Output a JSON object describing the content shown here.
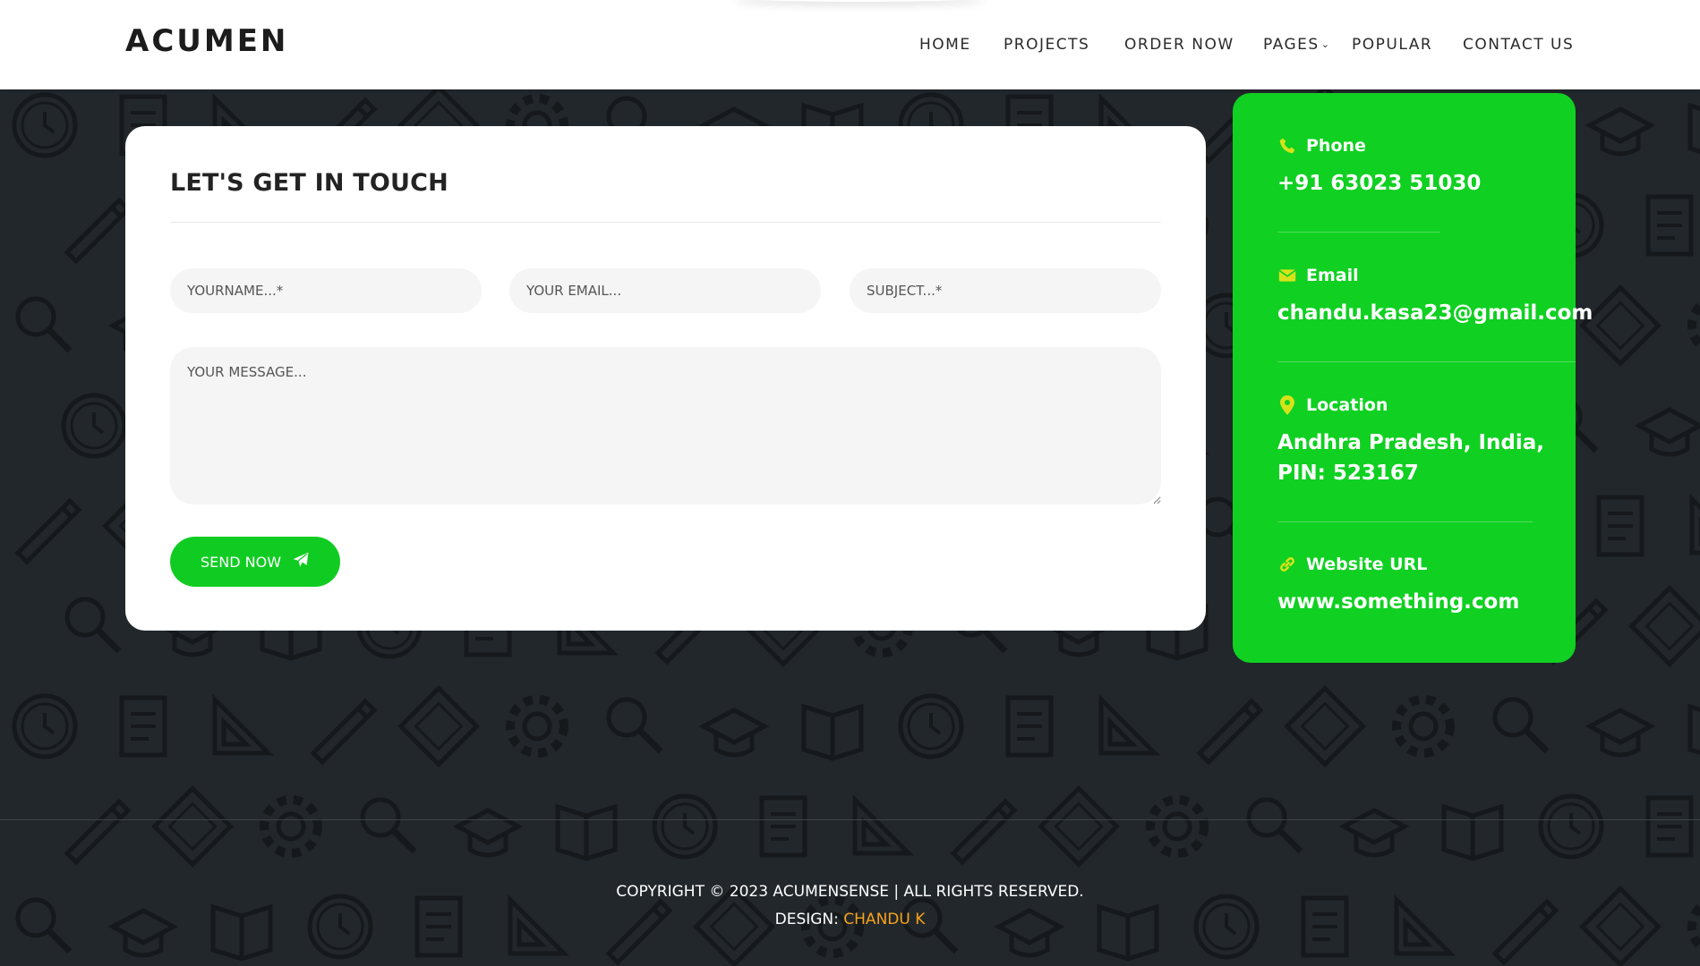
{
  "header": {
    "logo": "ACUMEN",
    "nav": [
      {
        "label": "HOME"
      },
      {
        "label": "PROJECTS"
      },
      {
        "label": "ORDER NOW"
      },
      {
        "label": "PAGES"
      },
      {
        "label": "POPULAR"
      },
      {
        "label": "CONTACT US"
      }
    ]
  },
  "contact_form": {
    "title": "LET'S GET IN TOUCH",
    "name_placeholder": "YOURNAME...*",
    "email_placeholder": "YOUR EMAIL...",
    "subject_placeholder": "SUBJECT...*",
    "message_placeholder": "YOUR MESSAGE...",
    "send_label": "SEND NOW"
  },
  "info": {
    "phone_label": "Phone",
    "phone_value": "+91 63023 51030",
    "email_label": "Email",
    "email_value": "chandu.kasa23@gmail.com",
    "location_label": "Location",
    "location_line1": "Andhra Pradesh, India,",
    "location_line2": "PIN: 523167",
    "website_label": "Website URL",
    "website_value": "www.something.com"
  },
  "footer": {
    "copyright": "COPYRIGHT © 2023 ACUMENSENSE | ALL RIGHTS RESERVED.",
    "design_prefix": "DESIGN:",
    "designer": "CHANDU K"
  },
  "colors": {
    "accent_green": "#10cc22",
    "icon_yellow": "#d8e21a",
    "designer_orange": "#f5a31b",
    "background_dark": "#22272b"
  }
}
